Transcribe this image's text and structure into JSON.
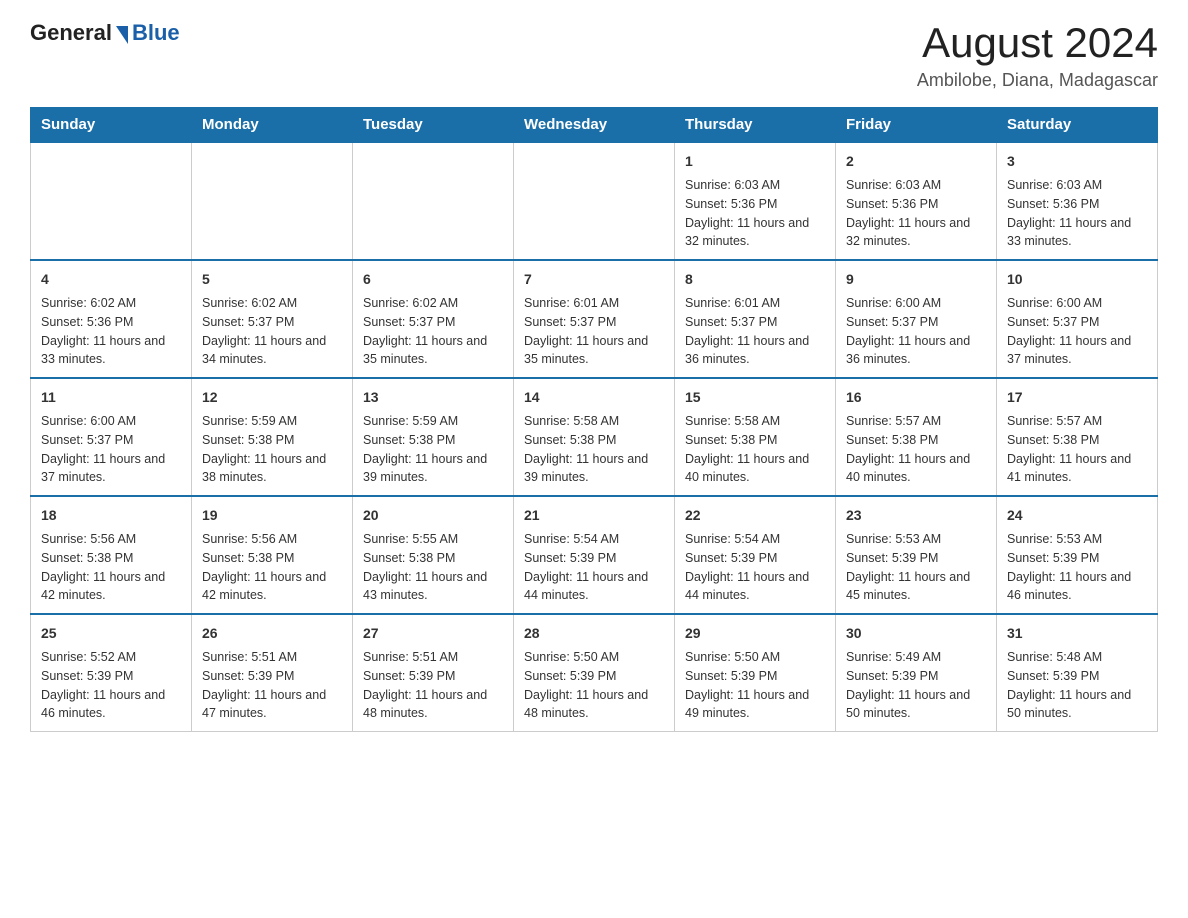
{
  "header": {
    "logo_general": "General",
    "logo_blue": "Blue",
    "month_title": "August 2024",
    "location": "Ambilobe, Diana, Madagascar"
  },
  "days_of_week": [
    "Sunday",
    "Monday",
    "Tuesday",
    "Wednesday",
    "Thursday",
    "Friday",
    "Saturday"
  ],
  "weeks": [
    [
      {
        "day": "",
        "sunrise": "",
        "sunset": "",
        "daylight": ""
      },
      {
        "day": "",
        "sunrise": "",
        "sunset": "",
        "daylight": ""
      },
      {
        "day": "",
        "sunrise": "",
        "sunset": "",
        "daylight": ""
      },
      {
        "day": "",
        "sunrise": "",
        "sunset": "",
        "daylight": ""
      },
      {
        "day": "1",
        "sunrise": "Sunrise: 6:03 AM",
        "sunset": "Sunset: 5:36 PM",
        "daylight": "Daylight: 11 hours and 32 minutes."
      },
      {
        "day": "2",
        "sunrise": "Sunrise: 6:03 AM",
        "sunset": "Sunset: 5:36 PM",
        "daylight": "Daylight: 11 hours and 32 minutes."
      },
      {
        "day": "3",
        "sunrise": "Sunrise: 6:03 AM",
        "sunset": "Sunset: 5:36 PM",
        "daylight": "Daylight: 11 hours and 33 minutes."
      }
    ],
    [
      {
        "day": "4",
        "sunrise": "Sunrise: 6:02 AM",
        "sunset": "Sunset: 5:36 PM",
        "daylight": "Daylight: 11 hours and 33 minutes."
      },
      {
        "day": "5",
        "sunrise": "Sunrise: 6:02 AM",
        "sunset": "Sunset: 5:37 PM",
        "daylight": "Daylight: 11 hours and 34 minutes."
      },
      {
        "day": "6",
        "sunrise": "Sunrise: 6:02 AM",
        "sunset": "Sunset: 5:37 PM",
        "daylight": "Daylight: 11 hours and 35 minutes."
      },
      {
        "day": "7",
        "sunrise": "Sunrise: 6:01 AM",
        "sunset": "Sunset: 5:37 PM",
        "daylight": "Daylight: 11 hours and 35 minutes."
      },
      {
        "day": "8",
        "sunrise": "Sunrise: 6:01 AM",
        "sunset": "Sunset: 5:37 PM",
        "daylight": "Daylight: 11 hours and 36 minutes."
      },
      {
        "day": "9",
        "sunrise": "Sunrise: 6:00 AM",
        "sunset": "Sunset: 5:37 PM",
        "daylight": "Daylight: 11 hours and 36 minutes."
      },
      {
        "day": "10",
        "sunrise": "Sunrise: 6:00 AM",
        "sunset": "Sunset: 5:37 PM",
        "daylight": "Daylight: 11 hours and 37 minutes."
      }
    ],
    [
      {
        "day": "11",
        "sunrise": "Sunrise: 6:00 AM",
        "sunset": "Sunset: 5:37 PM",
        "daylight": "Daylight: 11 hours and 37 minutes."
      },
      {
        "day": "12",
        "sunrise": "Sunrise: 5:59 AM",
        "sunset": "Sunset: 5:38 PM",
        "daylight": "Daylight: 11 hours and 38 minutes."
      },
      {
        "day": "13",
        "sunrise": "Sunrise: 5:59 AM",
        "sunset": "Sunset: 5:38 PM",
        "daylight": "Daylight: 11 hours and 39 minutes."
      },
      {
        "day": "14",
        "sunrise": "Sunrise: 5:58 AM",
        "sunset": "Sunset: 5:38 PM",
        "daylight": "Daylight: 11 hours and 39 minutes."
      },
      {
        "day": "15",
        "sunrise": "Sunrise: 5:58 AM",
        "sunset": "Sunset: 5:38 PM",
        "daylight": "Daylight: 11 hours and 40 minutes."
      },
      {
        "day": "16",
        "sunrise": "Sunrise: 5:57 AM",
        "sunset": "Sunset: 5:38 PM",
        "daylight": "Daylight: 11 hours and 40 minutes."
      },
      {
        "day": "17",
        "sunrise": "Sunrise: 5:57 AM",
        "sunset": "Sunset: 5:38 PM",
        "daylight": "Daylight: 11 hours and 41 minutes."
      }
    ],
    [
      {
        "day": "18",
        "sunrise": "Sunrise: 5:56 AM",
        "sunset": "Sunset: 5:38 PM",
        "daylight": "Daylight: 11 hours and 42 minutes."
      },
      {
        "day": "19",
        "sunrise": "Sunrise: 5:56 AM",
        "sunset": "Sunset: 5:38 PM",
        "daylight": "Daylight: 11 hours and 42 minutes."
      },
      {
        "day": "20",
        "sunrise": "Sunrise: 5:55 AM",
        "sunset": "Sunset: 5:38 PM",
        "daylight": "Daylight: 11 hours and 43 minutes."
      },
      {
        "day": "21",
        "sunrise": "Sunrise: 5:54 AM",
        "sunset": "Sunset: 5:39 PM",
        "daylight": "Daylight: 11 hours and 44 minutes."
      },
      {
        "day": "22",
        "sunrise": "Sunrise: 5:54 AM",
        "sunset": "Sunset: 5:39 PM",
        "daylight": "Daylight: 11 hours and 44 minutes."
      },
      {
        "day": "23",
        "sunrise": "Sunrise: 5:53 AM",
        "sunset": "Sunset: 5:39 PM",
        "daylight": "Daylight: 11 hours and 45 minutes."
      },
      {
        "day": "24",
        "sunrise": "Sunrise: 5:53 AM",
        "sunset": "Sunset: 5:39 PM",
        "daylight": "Daylight: 11 hours and 46 minutes."
      }
    ],
    [
      {
        "day": "25",
        "sunrise": "Sunrise: 5:52 AM",
        "sunset": "Sunset: 5:39 PM",
        "daylight": "Daylight: 11 hours and 46 minutes."
      },
      {
        "day": "26",
        "sunrise": "Sunrise: 5:51 AM",
        "sunset": "Sunset: 5:39 PM",
        "daylight": "Daylight: 11 hours and 47 minutes."
      },
      {
        "day": "27",
        "sunrise": "Sunrise: 5:51 AM",
        "sunset": "Sunset: 5:39 PM",
        "daylight": "Daylight: 11 hours and 48 minutes."
      },
      {
        "day": "28",
        "sunrise": "Sunrise: 5:50 AM",
        "sunset": "Sunset: 5:39 PM",
        "daylight": "Daylight: 11 hours and 48 minutes."
      },
      {
        "day": "29",
        "sunrise": "Sunrise: 5:50 AM",
        "sunset": "Sunset: 5:39 PM",
        "daylight": "Daylight: 11 hours and 49 minutes."
      },
      {
        "day": "30",
        "sunrise": "Sunrise: 5:49 AM",
        "sunset": "Sunset: 5:39 PM",
        "daylight": "Daylight: 11 hours and 50 minutes."
      },
      {
        "day": "31",
        "sunrise": "Sunrise: 5:48 AM",
        "sunset": "Sunset: 5:39 PM",
        "daylight": "Daylight: 11 hours and 50 minutes."
      }
    ]
  ]
}
